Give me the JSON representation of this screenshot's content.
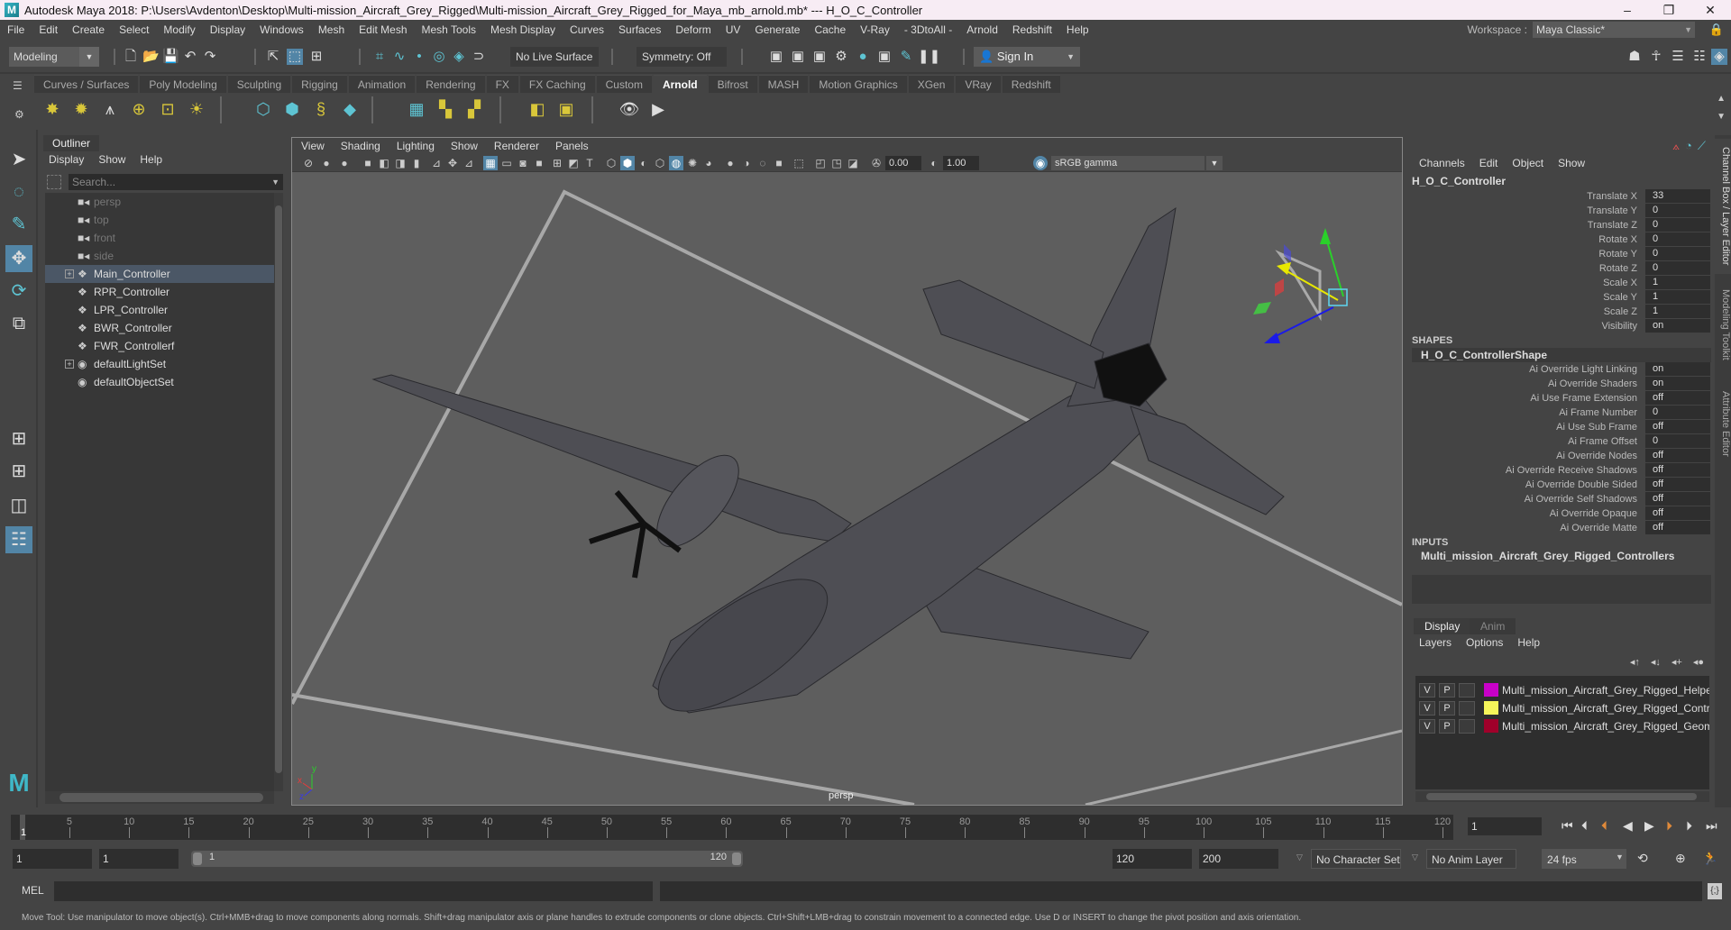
{
  "window": {
    "title": "Autodesk Maya 2018: P:\\Users\\Avdenton\\Desktop\\Multi-mission_Aircraft_Grey_Rigged\\Multi-mission_Aircraft_Grey_Rigged_for_Maya_mb_arnold.mb*  ---  H_O_C_Controller",
    "logo": "M",
    "controls": {
      "minimize": "–",
      "maximize": "❐",
      "close": "✕"
    }
  },
  "menubar": {
    "items": [
      "File",
      "Edit",
      "Create",
      "Select",
      "Modify",
      "Display",
      "Windows",
      "Mesh",
      "Edit Mesh",
      "Mesh Tools",
      "Mesh Display",
      "Curves",
      "Surfaces",
      "Deform",
      "UV",
      "Generate",
      "Cache",
      "V-Ray",
      "- 3DtoAll -",
      "Arnold",
      "Redshift",
      "Help"
    ],
    "workspace_label": "Workspace :",
    "workspace_value": "Maya Classic*"
  },
  "statusline": {
    "mode": "Modeling",
    "live_surface": "No Live Surface",
    "symmetry": "Symmetry: Off",
    "sign_in": "Sign In"
  },
  "shelf": {
    "tabs": [
      "Curves / Surfaces",
      "Poly Modeling",
      "Sculpting",
      "Rigging",
      "Animation",
      "Rendering",
      "FX",
      "FX Caching",
      "Custom",
      "Arnold",
      "Bifrost",
      "MASH",
      "Motion Graphics",
      "XGen",
      "VRay",
      "Redshift"
    ],
    "active_tab": "Arnold"
  },
  "outliner": {
    "title": "Outliner",
    "menus": [
      "Display",
      "Show",
      "Help"
    ],
    "search_placeholder": "Search...",
    "items": [
      {
        "label": "persp",
        "type": "camera",
        "dim": true
      },
      {
        "label": "top",
        "type": "camera",
        "dim": true
      },
      {
        "label": "front",
        "type": "camera",
        "dim": true
      },
      {
        "label": "side",
        "type": "camera",
        "dim": true
      },
      {
        "label": "Main_Controller",
        "type": "transform",
        "expandable": true,
        "selected": true
      },
      {
        "label": "RPR_Controller",
        "type": "transform"
      },
      {
        "label": "LPR_Controller",
        "type": "transform"
      },
      {
        "label": "BWR_Controller",
        "type": "transform"
      },
      {
        "label": "FWR_Controllerf",
        "type": "transform"
      },
      {
        "label": "defaultLightSet",
        "type": "set",
        "expandable": true
      },
      {
        "label": "defaultObjectSet",
        "type": "set"
      }
    ]
  },
  "viewport": {
    "menus": [
      "View",
      "Shading",
      "Lighting",
      "Show",
      "Renderer",
      "Panels"
    ],
    "exposure": "0.00",
    "gamma": "1.00",
    "color_space": "sRGB gamma",
    "camera_label": "persp",
    "axis": {
      "x": "x",
      "y": "y",
      "z": "z"
    }
  },
  "channelbox": {
    "menus": [
      "Channels",
      "Edit",
      "Object",
      "Show"
    ],
    "object": "H_O_C_Controller",
    "channels": [
      {
        "name": "Translate X",
        "value": "33"
      },
      {
        "name": "Translate Y",
        "value": "0"
      },
      {
        "name": "Translate Z",
        "value": "0"
      },
      {
        "name": "Rotate X",
        "value": "0"
      },
      {
        "name": "Rotate Y",
        "value": "0"
      },
      {
        "name": "Rotate Z",
        "value": "0"
      },
      {
        "name": "Scale X",
        "value": "1"
      },
      {
        "name": "Scale Y",
        "value": "1"
      },
      {
        "name": "Scale Z",
        "value": "1"
      },
      {
        "name": "Visibility",
        "value": "on"
      }
    ],
    "shapes_header": "SHAPES",
    "shape_name": "H_O_C_ControllerShape",
    "shape_attrs": [
      {
        "name": "Ai Override Light Linking",
        "value": "on"
      },
      {
        "name": "Ai Override Shaders",
        "value": "on"
      },
      {
        "name": "Ai Use Frame Extension",
        "value": "off"
      },
      {
        "name": "Ai Frame Number",
        "value": "0"
      },
      {
        "name": "Ai Use Sub Frame",
        "value": "off"
      },
      {
        "name": "Ai Frame Offset",
        "value": "0"
      },
      {
        "name": "Ai Override Nodes",
        "value": "off"
      },
      {
        "name": "Ai Override Receive Shadows",
        "value": "off"
      },
      {
        "name": "Ai Override Double Sided",
        "value": "off"
      },
      {
        "name": "Ai Override Self Shadows",
        "value": "off"
      },
      {
        "name": "Ai Override Opaque",
        "value": "off"
      },
      {
        "name": "Ai Override Matte",
        "value": "off"
      }
    ],
    "inputs_header": "INPUTS",
    "input_name": "Multi_mission_Aircraft_Grey_Rigged_Controllers"
  },
  "sidetabs": [
    "Channel Box / Layer Editor",
    "Modeling Toolkit",
    "Attribute Editor"
  ],
  "layereditor": {
    "tabs": [
      "Display",
      "Anim"
    ],
    "menus": [
      "Layers",
      "Options",
      "Help"
    ],
    "layers": [
      {
        "v": "V",
        "p": "P",
        "color": "#c800c8",
        "name": "Multi_mission_Aircraft_Grey_Rigged_Helpers"
      },
      {
        "v": "V",
        "p": "P",
        "color": "#f5f55a",
        "name": "Multi_mission_Aircraft_Grey_Rigged_Controllers"
      },
      {
        "v": "V",
        "p": "P",
        "color": "#a0002a",
        "name": "Multi_mission_Aircraft_Grey_Rigged_Geometry"
      }
    ]
  },
  "timeslider": {
    "start": 1,
    "end": 120,
    "labels": [
      5,
      10,
      15,
      20,
      25,
      30,
      35,
      40,
      45,
      50,
      55,
      60,
      65,
      70,
      75,
      80,
      85,
      90,
      95,
      100,
      105,
      110,
      115,
      120
    ],
    "current_frame": "1",
    "current_field": "1"
  },
  "rangeslider": {
    "start_field": "1",
    "playback_start": "1",
    "range_lo": "1",
    "range_hi": "120",
    "playback_end": "120",
    "end_field": "200",
    "character_set": "No Character Set",
    "anim_layer": "No Anim Layer",
    "fps": "24 fps"
  },
  "commandline": {
    "label": "MEL"
  },
  "helpline": {
    "text": "Move Tool: Use manipulator to move object(s). Ctrl+MMB+drag to move components along normals. Shift+drag manipulator axis or plane handles to extrude components or clone objects. Ctrl+Shift+LMB+drag to constrain movement to a connected edge. Use D or INSERT to change the pivot position and axis orientation."
  }
}
